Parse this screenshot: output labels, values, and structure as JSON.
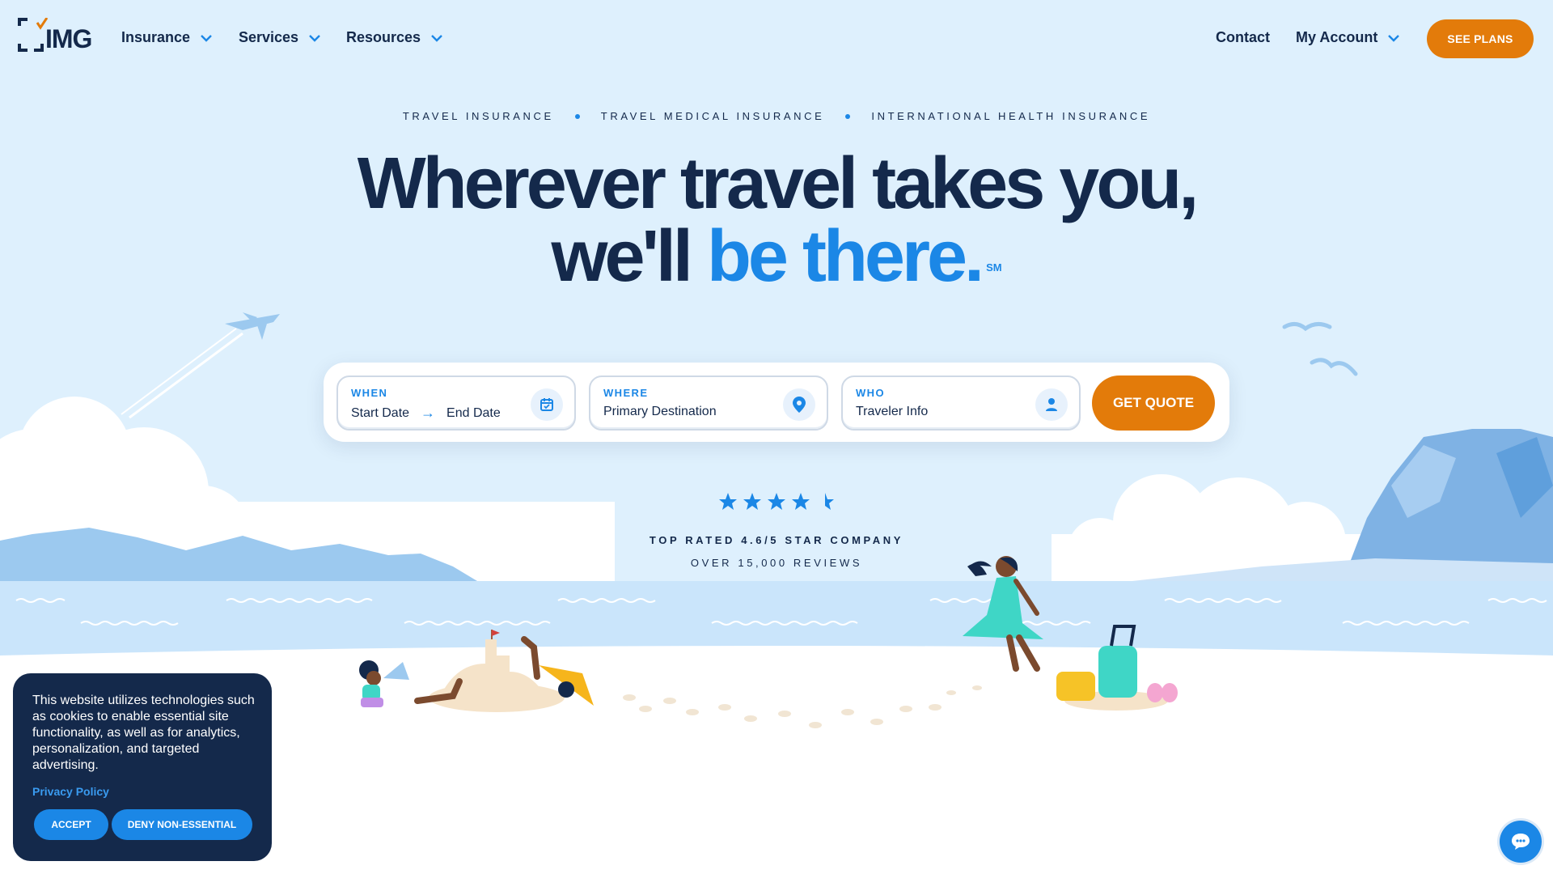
{
  "brand": {
    "logo_text": "IMG",
    "accent_orange": "#e37b0a",
    "accent_blue": "#1b87e6",
    "navy": "#14294b",
    "sky": "#def0fd"
  },
  "nav": {
    "items": [
      {
        "label": "Insurance"
      },
      {
        "label": "Services"
      },
      {
        "label": "Resources"
      }
    ],
    "contact": "Contact",
    "account": "My Account",
    "cta": "SEE PLANS"
  },
  "hero": {
    "kickers": [
      "TRAVEL INSURANCE",
      "TRAVEL MEDICAL INSURANCE",
      "INTERNATIONAL HEALTH INSURANCE"
    ],
    "headline_line1": "Wherever travel takes you,",
    "headline_line2_a": "we'll",
    "headline_line2_b": "be there.",
    "service_mark": "SM"
  },
  "quote": {
    "when_label": "WHEN",
    "start_date": "Start Date",
    "end_date": "End Date",
    "where_label": "WHERE",
    "where_value": "Primary Destination",
    "who_label": "WHO",
    "who_value": "Traveler Info",
    "cta": "GET QUOTE",
    "icons": [
      "calendar-icon",
      "map-pin-icon",
      "person-icon"
    ]
  },
  "rating": {
    "value": 4.6,
    "max": 5,
    "title": "TOP RATED 4.6/5 STAR COMPANY",
    "subtitle": "OVER 15,000 REVIEWS"
  },
  "cookie": {
    "text": "This website utilizes technologies such as cookies to enable essential site functionality, as well as for analytics, personalization, and targeted advertising.",
    "policy_link": "Privacy Policy",
    "accept": "ACCEPT",
    "deny": "DENY NON-ESSENTIAL"
  },
  "chat": {
    "icon": "chat-bubble-icon"
  }
}
